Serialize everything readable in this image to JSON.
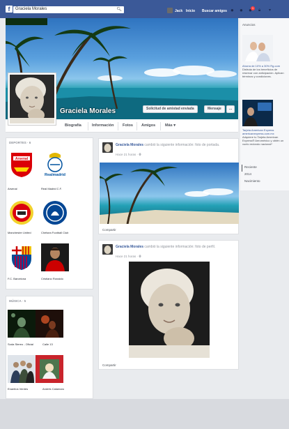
{
  "topbar": {
    "logo": "f",
    "search_value": "Graciela Morales",
    "user_name": "Jack",
    "home_label": "Inicio",
    "find_friends_label": "Buscar amigos",
    "notif_count": "1"
  },
  "profile": {
    "name": "Graciela Morales",
    "friend_request_label": "Solicitud de amistad enviada",
    "message_label": "Mensaje",
    "more_button": "...",
    "tabs": [
      "Biografía",
      "Información",
      "Fotos",
      "Amigos",
      "Más ▾"
    ]
  },
  "sports": {
    "title": "DEPORTES · 6",
    "items": [
      "Arsenal",
      "Real Madrid C.F.",
      "Manchester United",
      "Chelsea Football Club",
      "F.C. Barcelona",
      "Cristiano Ronaldo"
    ]
  },
  "music": {
    "title": "MÚSICA · 5",
    "items": [
      "Soda Stereo - Oficial",
      "Calle 13",
      "Enanitos Verdes",
      "Andrés Calamaro"
    ]
  },
  "logos": {
    "arsenal": "Arsenal",
    "realmadrid": "Realmadrid"
  },
  "posts": [
    {
      "name": "Graciela Morales",
      "text": "cambió la siguiente información: foto de portada.",
      "time": "Hace 21 horas",
      "share": "Compartir"
    },
    {
      "name": "Graciela Morales",
      "text": "cambió la siguiente información: foto de perfil.",
      "time": "Hace 21 horas",
      "share": "Compartir"
    }
  ],
  "ads": {
    "title": "Anuncios",
    "ad1_link": "Ahorra de 10% a 30% Rg.com",
    "ad1_text": "Disfruta de los beneficios de reservar con anticipación. Aplican términos y condiciones.",
    "ad2_link": "Tarjeta American Express americanexpress.com.mx",
    "ad2_text": "Adquiere tu Tarjeta American Express® Aeroméxico y obtén un vuelo redondo nacional*"
  },
  "timeline": [
    "Reciente",
    "2014",
    "Nacimiento"
  ],
  "colors": {
    "facebook_blue": "#3b5998",
    "link_blue": "#365899",
    "background": "#e9ebee"
  }
}
